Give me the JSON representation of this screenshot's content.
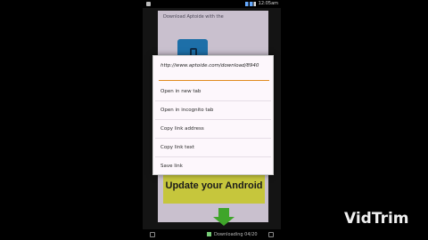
{
  "page": {
    "header_text": "Download Aptoide with the"
  },
  "status_bar": {
    "time": "12:05am"
  },
  "context_menu": {
    "link_url": "http://www.aptoide.com/download/8940",
    "items": [
      {
        "label": "Open in new tab"
      },
      {
        "label": "Open in incognito tab"
      },
      {
        "label": "Copy link address"
      },
      {
        "label": "Copy link text"
      },
      {
        "label": "Save link"
      }
    ]
  },
  "banner": {
    "text": "Update your Android"
  },
  "nav_bar": {
    "download_label": "Downloading 04/20"
  },
  "watermark": {
    "text": "VidTrim"
  },
  "colors": {
    "accent_divider": "#e08a1e",
    "banner_bg": "#c6c63c",
    "download_icon": "#3fa52a"
  }
}
